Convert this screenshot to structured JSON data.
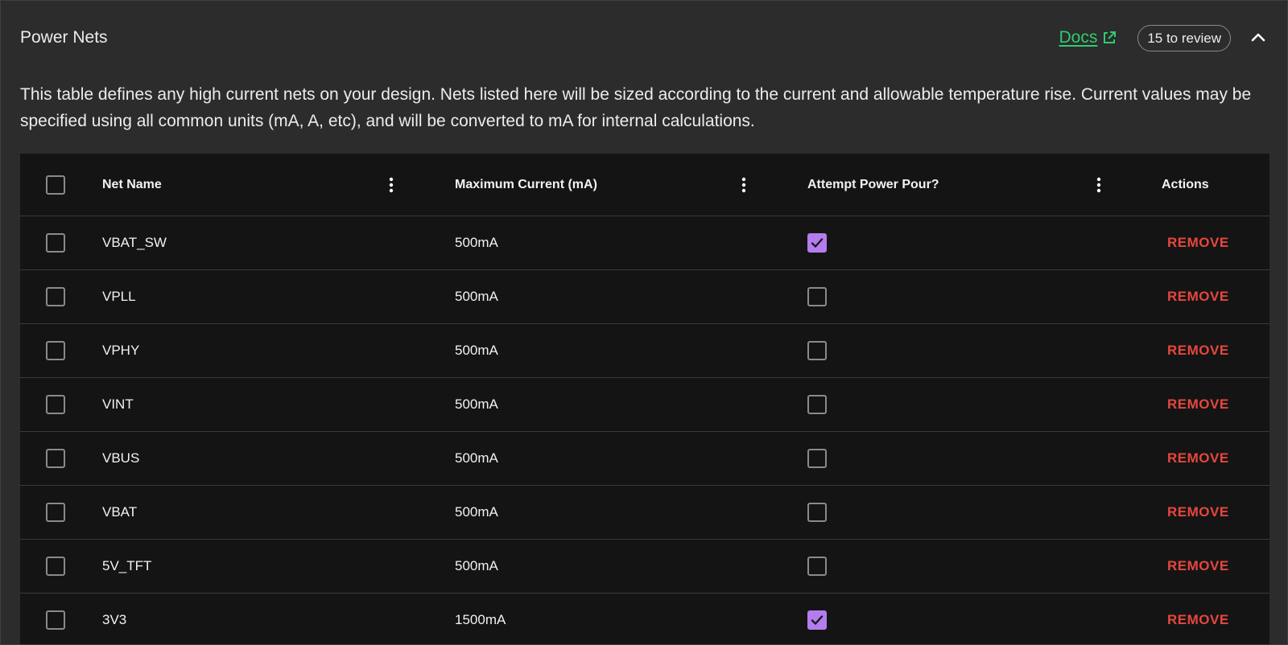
{
  "header": {
    "title": "Power Nets",
    "docs_label": "Docs",
    "review_badge": "15 to review"
  },
  "description": "This table defines any high current nets on your design. Nets listed here will be sized according to the current and allowable temperature rise. Current values may be specified using all common units (mA, A, etc), and will be converted to mA for internal calculations.",
  "table": {
    "columns": [
      "Net Name",
      "Maximum Current (mA)",
      "Attempt Power Pour?",
      "Actions"
    ],
    "rows": [
      {
        "name": "VBAT_SW",
        "current": "500mA",
        "pour": true,
        "action": "REMOVE"
      },
      {
        "name": "VPLL",
        "current": "500mA",
        "pour": false,
        "action": "REMOVE"
      },
      {
        "name": "VPHY",
        "current": "500mA",
        "pour": false,
        "action": "REMOVE"
      },
      {
        "name": "VINT",
        "current": "500mA",
        "pour": false,
        "action": "REMOVE"
      },
      {
        "name": "VBUS",
        "current": "500mA",
        "pour": false,
        "action": "REMOVE"
      },
      {
        "name": "VBAT",
        "current": "500mA",
        "pour": false,
        "action": "REMOVE"
      },
      {
        "name": "5V_TFT",
        "current": "500mA",
        "pour": false,
        "action": "REMOVE"
      },
      {
        "name": "3V3",
        "current": "1500mA",
        "pour": true,
        "action": "REMOVE"
      }
    ]
  },
  "colors": {
    "accent_link": "#2ecc71",
    "checkbox_checked": "#b57cf0",
    "remove_action": "#e5473d"
  },
  "icons": {
    "docs_link": "external-link-icon",
    "collapse": "chevron-up-icon",
    "column_menu": "more-vertical-icon",
    "checked": "check-icon"
  }
}
